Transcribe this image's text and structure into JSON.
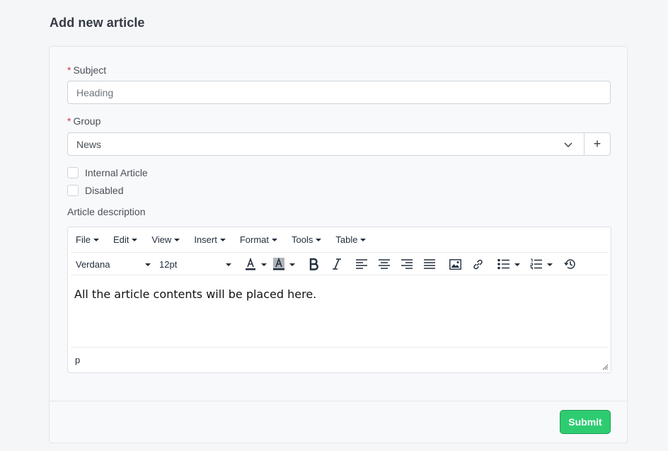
{
  "page": {
    "title": "Add new article"
  },
  "form": {
    "required_marker": "*",
    "subject": {
      "label": "Subject",
      "placeholder": "Heading"
    },
    "group": {
      "label": "Group",
      "value": "News",
      "add_symbol": "+"
    },
    "internal_article": {
      "label": "Internal Article",
      "checked": false
    },
    "disabled": {
      "label": "Disabled",
      "checked": false
    },
    "description_label": "Article description"
  },
  "editor": {
    "menus": [
      "File",
      "Edit",
      "View",
      "Insert",
      "Format",
      "Tools",
      "Table"
    ],
    "font_family": "Verdana",
    "font_size": "12pt",
    "content": "All the article contents will be placed here.",
    "status_path": "p",
    "toolbar_icons": [
      "text-color-icon",
      "background-color-icon",
      "bold-icon",
      "italic-icon",
      "align-left-icon",
      "align-center-icon",
      "align-right-icon",
      "justify-icon",
      "image-icon",
      "link-icon",
      "bullet-list-icon",
      "numbered-list-icon",
      "history-icon"
    ]
  },
  "actions": {
    "submit_label": "Submit"
  },
  "colors": {
    "accent": "#2ecc71",
    "required": "#dc3545"
  }
}
